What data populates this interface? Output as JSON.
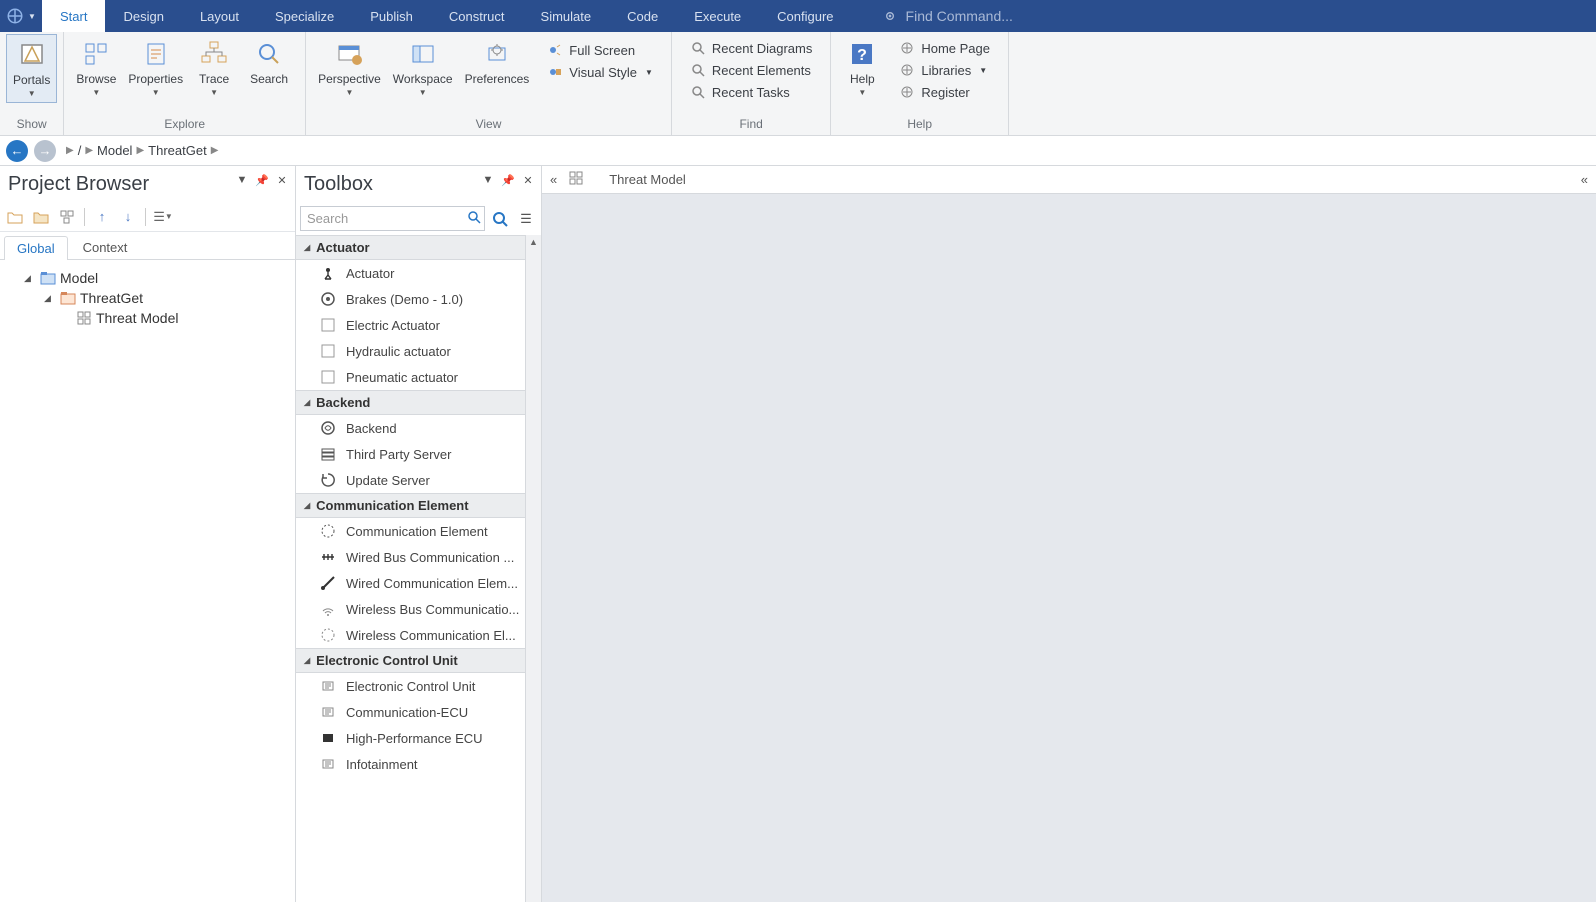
{
  "menubar": {
    "items": [
      "Start",
      "Design",
      "Layout",
      "Specialize",
      "Publish",
      "Construct",
      "Simulate",
      "Code",
      "Execute",
      "Configure"
    ],
    "active_index": 0,
    "find_placeholder": "Find Command..."
  },
  "ribbon": {
    "groups": [
      {
        "label": "Show",
        "buttons": [
          {
            "label": "Portals",
            "icon": "portals-icon",
            "dropdown": true,
            "active": true
          }
        ]
      },
      {
        "label": "Explore",
        "buttons": [
          {
            "label": "Browse",
            "icon": "browse-icon",
            "dropdown": true
          },
          {
            "label": "Properties",
            "icon": "properties-icon",
            "dropdown": true
          },
          {
            "label": "Trace",
            "icon": "trace-icon",
            "dropdown": true
          },
          {
            "label": "Search",
            "icon": "search-icon",
            "dropdown": false
          }
        ]
      },
      {
        "label": "View",
        "buttons": [
          {
            "label": "Perspective",
            "icon": "perspective-icon",
            "dropdown": true
          },
          {
            "label": "Workspace",
            "icon": "workspace-icon",
            "dropdown": true
          },
          {
            "label": "Preferences",
            "icon": "preferences-icon",
            "dropdown": false
          }
        ],
        "column": [
          {
            "label": "Full Screen",
            "icon": "fullscreen-icon",
            "dropdown": false
          },
          {
            "label": "Visual Style",
            "icon": "visualstyle-icon",
            "dropdown": true
          }
        ]
      },
      {
        "label": "Find",
        "column": [
          {
            "label": "Recent Diagrams",
            "icon": "find-icon"
          },
          {
            "label": "Recent Elements",
            "icon": "find-icon"
          },
          {
            "label": "Recent Tasks",
            "icon": "find-icon"
          }
        ]
      },
      {
        "label": "Help",
        "buttons": [
          {
            "label": "Help",
            "icon": "help-icon",
            "dropdown": true
          }
        ],
        "column": [
          {
            "label": "Home Page",
            "icon": "sparx-icon"
          },
          {
            "label": "Libraries",
            "icon": "sparx-icon",
            "dropdown": true
          },
          {
            "label": "Register",
            "icon": "sparx-icon"
          }
        ]
      }
    ]
  },
  "breadcrumb": {
    "items": [
      "/",
      "Model",
      "ThreatGet"
    ]
  },
  "project_browser": {
    "title": "Project Browser",
    "tabs": [
      "Global",
      "Context"
    ],
    "active_tab": 0,
    "tree": {
      "root": {
        "label": "Model",
        "icon": "model-icon"
      },
      "child": {
        "label": "ThreatGet",
        "icon": "package-icon"
      },
      "leaf": {
        "label": "Threat Model",
        "icon": "diagram-icon"
      }
    }
  },
  "toolbox": {
    "title": "Toolbox",
    "search_placeholder": "Search",
    "categories": [
      {
        "name": "Actuator",
        "items": [
          {
            "label": "Actuator",
            "icon": "actuator-icon"
          },
          {
            "label": "Brakes (Demo - 1.0)",
            "icon": "brakes-icon"
          },
          {
            "label": "Electric Actuator",
            "icon": "elec-actuator-icon"
          },
          {
            "label": "Hydraulic actuator",
            "icon": "hydraulic-icon"
          },
          {
            "label": "Pneumatic actuator",
            "icon": "pneumatic-icon"
          }
        ]
      },
      {
        "name": "Backend",
        "items": [
          {
            "label": "Backend",
            "icon": "backend-icon"
          },
          {
            "label": "Third Party Server",
            "icon": "server-icon"
          },
          {
            "label": "Update Server",
            "icon": "update-icon"
          }
        ]
      },
      {
        "name": "Communication Element",
        "items": [
          {
            "label": "Communication Element",
            "icon": "comm-icon"
          },
          {
            "label": "Wired Bus Communication ...",
            "icon": "wiredbus-icon"
          },
          {
            "label": "Wired Communication Elem...",
            "icon": "wired-icon"
          },
          {
            "label": "Wireless Bus Communicatio...",
            "icon": "wirelessbus-icon"
          },
          {
            "label": "Wireless Communication El...",
            "icon": "wireless-icon"
          }
        ]
      },
      {
        "name": "Electronic Control Unit",
        "items": [
          {
            "label": "Electronic Control Unit",
            "icon": "ecu-icon"
          },
          {
            "label": "Communication-ECU",
            "icon": "ecu-icon"
          },
          {
            "label": "High-Performance ECU",
            "icon": "ecu-hp-icon"
          },
          {
            "label": "Infotainment",
            "icon": "ecu-icon"
          }
        ]
      }
    ]
  },
  "canvas": {
    "title": "Threat Model"
  }
}
